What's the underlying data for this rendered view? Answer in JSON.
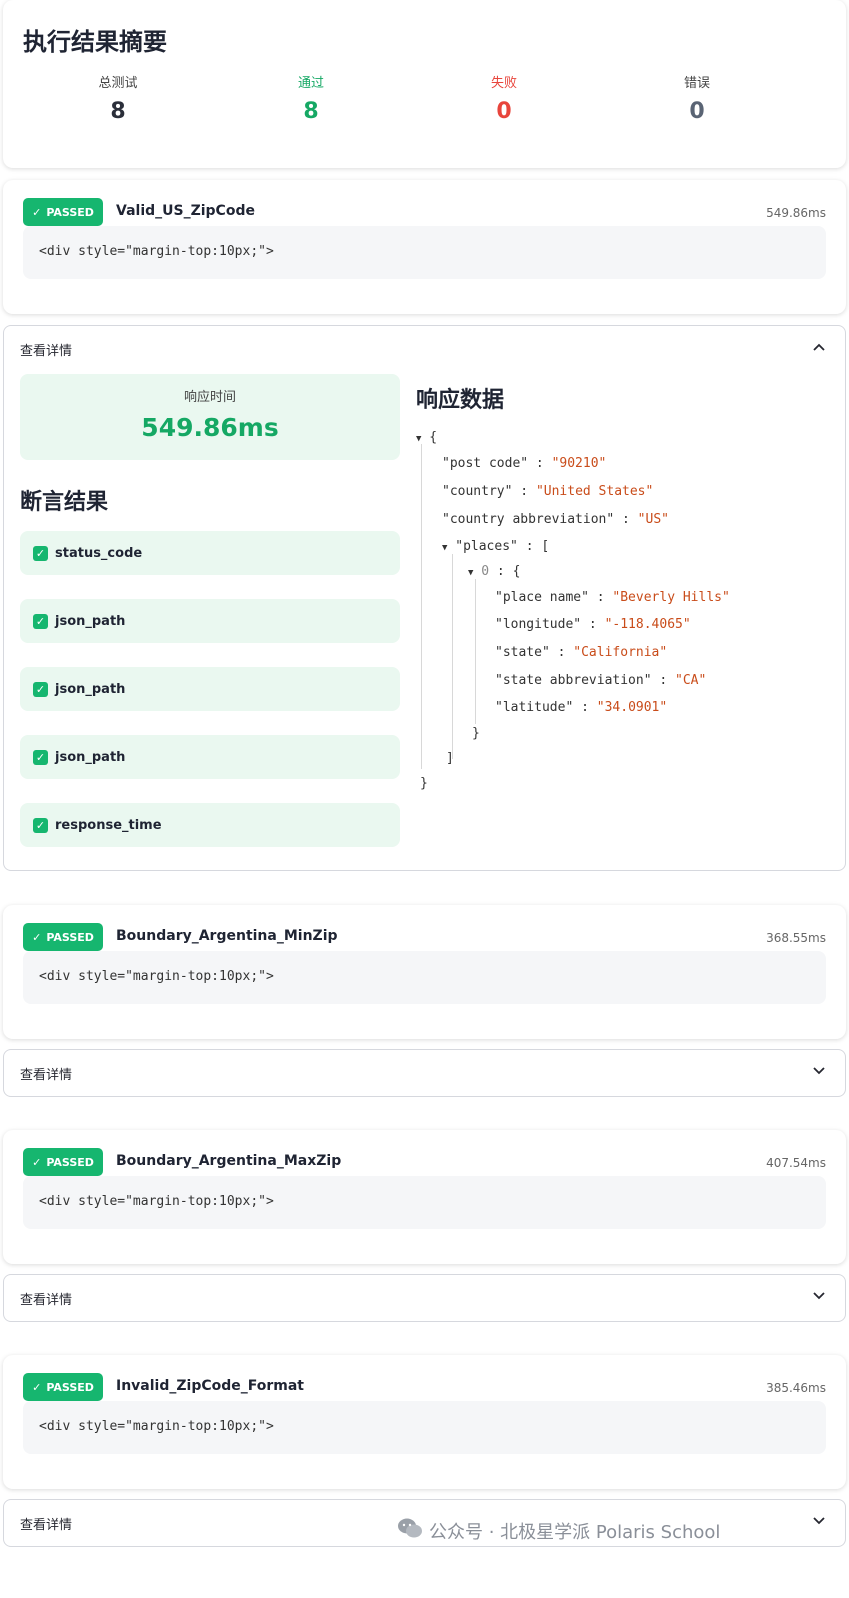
{
  "summary": {
    "title": "执行结果摘要",
    "stats": [
      {
        "label": "总测试",
        "value": "8",
        "color": "#2b2f3a",
        "label_color": "#444444"
      },
      {
        "label": "通过",
        "value": "8",
        "color": "#15a864",
        "label_color": "#15a864"
      },
      {
        "label": "失败",
        "value": "0",
        "color": "#e8453c",
        "label_color": "#e8453c"
      },
      {
        "label": "错误",
        "value": "0",
        "color": "#5a6474",
        "label_color": "#444444"
      }
    ]
  },
  "tests": [
    {
      "status": "PASSED",
      "name": "Valid_US_ZipCode",
      "time": "549.86ms",
      "code": "<div style=\"margin-top:10px;\">"
    },
    {
      "status": "PASSED",
      "name": "Boundary_Argentina_MinZip",
      "time": "368.55ms",
      "code": "<div style=\"margin-top:10px;\">"
    },
    {
      "status": "PASSED",
      "name": "Boundary_Argentina_MaxZip",
      "time": "407.54ms",
      "code": "<div style=\"margin-top:10px;\">"
    },
    {
      "status": "PASSED",
      "name": "Invalid_ZipCode_Format",
      "time": "385.46ms",
      "code": "<div style=\"margin-top:10px;\">"
    }
  ],
  "expander": {
    "label": "查看详情",
    "chevron_up": "⌃",
    "chevron_down": "⌄"
  },
  "details": {
    "metric_label": "响应时间",
    "metric_value": "549.86ms",
    "assert_title": "断言结果",
    "assertions": [
      "status_code",
      "json_path",
      "json_path",
      "json_path",
      "response_time"
    ],
    "response_title": "响应数据"
  },
  "json_view": {
    "open_brace": "{",
    "close_brace": "}",
    "open_bracket": "[",
    "close_bracket": "]",
    "post_code_key": "\"post code\"",
    "post_code_val": "\"90210\"",
    "country_key": "\"country\"",
    "country_val": "\"United States\"",
    "abbr_key": "\"country abbreviation\"",
    "abbr_val": "\"US\"",
    "places_key": "\"places\"",
    "index0": "0",
    "place_name_key": "\"place name\"",
    "place_name_val": "\"Beverly Hills\"",
    "longitude_key": "\"longitude\"",
    "longitude_val": "\"-118.4065\"",
    "state_key": "\"state\"",
    "state_val": "\"California\"",
    "state_abbr_key": "\"state abbreviation\"",
    "state_abbr_val": "\"CA\"",
    "latitude_key": "\"latitude\"",
    "latitude_val": "\"34.0901\"",
    "colon": ":"
  },
  "watermark": {
    "text": "公众号 · 北极星学派 Polaris School"
  },
  "colors": {
    "accent": "#16b66f",
    "success_bg": "#eaf8f0",
    "string": "#c94c1a"
  }
}
